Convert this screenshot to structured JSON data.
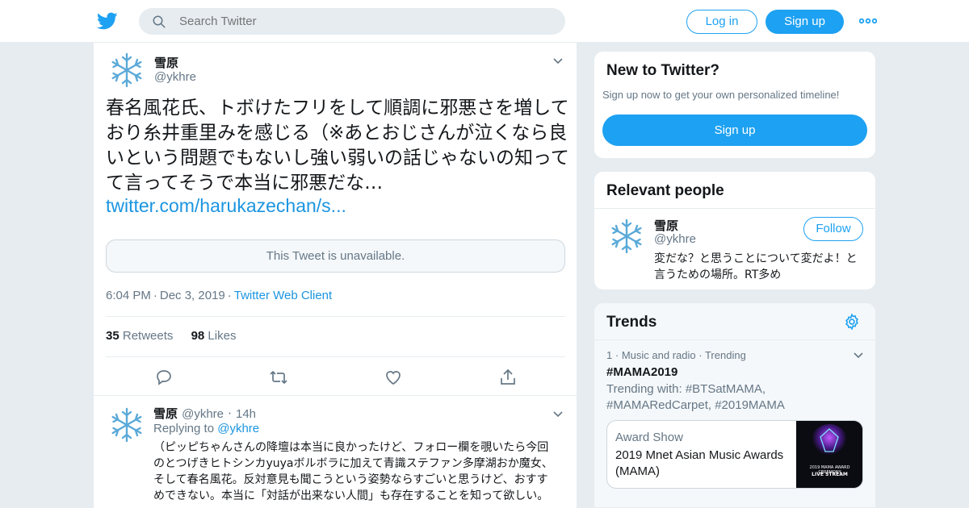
{
  "header": {
    "search_placeholder": "Search Twitter",
    "login_label": "Log in",
    "signup_label": "Sign up"
  },
  "tweet": {
    "author_name": "雪原",
    "author_handle": "@ykhre",
    "text": "春名風花氏、トボけたフリをして順調に邪悪さを増しており糸井重里みを感じる（※あとおじさんが泣くなら良いという問題でもないし強い弱いの話じゃないの知ってて言ってそうで本当に邪悪だな…",
    "link": "twitter.com/harukazechan/s...",
    "quoted_unavailable": "This Tweet is unavailable.",
    "time": "6:04 PM",
    "date": "Dec 3, 2019",
    "client": "Twitter Web Client",
    "retweets_count": "35",
    "retweets_label": "Retweets",
    "likes_count": "98",
    "likes_label": "Likes"
  },
  "reply": {
    "author_name": "雪原",
    "author_handle": "@ykhre",
    "age": "14h",
    "replying_to_label": "Replying to",
    "replying_to_handle": "@ykhre",
    "text": "（ピッピちゃんさんの降壇は本当に良かったけど、フォロー欄を覗いたら今回のとつげきヒトシンカyuyaボルボラに加えて青識ステファン多摩湖おか魔女、そして春名風花。反対意見も聞こうという姿勢ならすごいと思うけど、おすすめできない。本当に「対話が出来ない人間」も存在することを知って欲しい。"
  },
  "sidebar": {
    "new_to_twitter": {
      "title": "New to Twitter?",
      "subtitle": "Sign up now to get your own personalized timeline!",
      "button": "Sign up"
    },
    "relevant_people": {
      "title": "Relevant people",
      "name": "雪原",
      "handle": "@ykhre",
      "follow_label": "Follow",
      "bio": "変だな？と思うことについて変だよ！と言うための場所。RT多め"
    },
    "trends": {
      "title": "Trends",
      "items": [
        {
          "rank": "1",
          "category": "Music and radio",
          "status": "Trending",
          "tag": "#MAMA2019",
          "trending_with": "Trending with: #BTSatMAMA, #MAMARedCarpet, #2019MAMA",
          "media_category": "Award Show",
          "media_title": "2019 Mnet Asian Music Awards (MAMA)",
          "thumb_text_a": "2019 MAMA AWARD CEREMONY",
          "thumb_text_b": "LIVE STREAM"
        }
      ]
    }
  },
  "colors": {
    "brand": "#1da1f2",
    "link": "#1b95e0",
    "secondary_text": "#657786",
    "border": "#e6ecf0",
    "page_bg": "#e6ecf0"
  },
  "icons": [
    "twitter-bird-icon",
    "search-icon",
    "more-dots-icon",
    "snowflake-avatar-icon",
    "chevron-down-icon",
    "reply-icon",
    "retweet-icon",
    "heart-icon",
    "share-icon",
    "gear-icon"
  ]
}
